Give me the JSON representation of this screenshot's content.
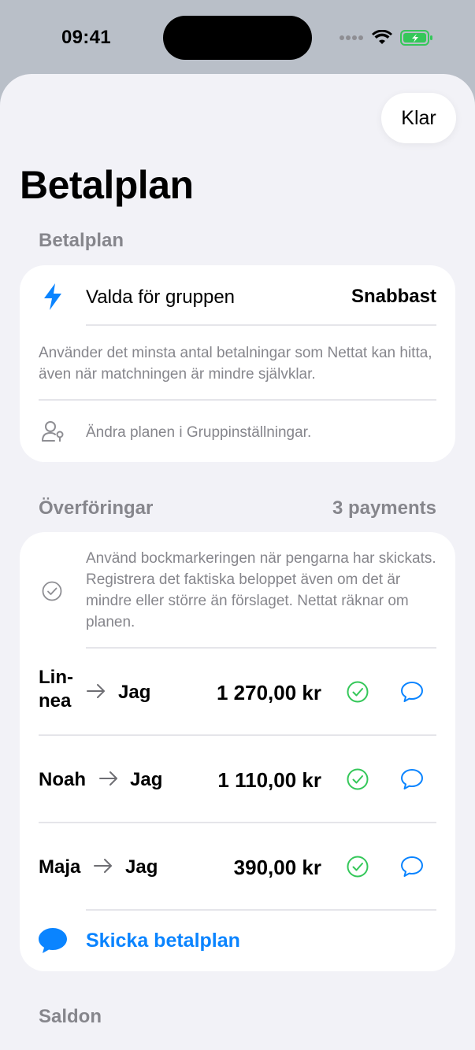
{
  "status": {
    "time": "09:41"
  },
  "header": {
    "done_label": "Klar",
    "title": "Betalplan"
  },
  "plan_section": {
    "header": "Betalplan",
    "row_label": "Valda för gruppen",
    "row_value": "Snabbast",
    "description": "Använder det minsta antal betalningar som Nettat kan hitta, även när matchningen är mindre självklar.",
    "settings_hint": "Ändra planen i Gruppinställningar."
  },
  "transfers_section": {
    "header": "Överföringar",
    "count": "3 payments",
    "info": "Använd bockmarkeringen när pengarna har skickats. Registrera det faktiska beloppet även om det är mindre eller större än förslaget. Nettat räknar om planen.",
    "payments": [
      {
        "from_line1": "Lin-",
        "from_line2": "nea",
        "to": "Jag",
        "amount": "1 270,00 kr"
      },
      {
        "from": "Noah",
        "to": "Jag",
        "amount": "1 110,00 kr"
      },
      {
        "from": "Maja",
        "to": "Jag",
        "amount": "390,00 kr"
      }
    ],
    "send_label": "Skicka betalplan"
  },
  "balances_section": {
    "header": "Saldon"
  },
  "colors": {
    "accent": "#0a84ff",
    "success": "#34c759",
    "secondary_text": "#86868c"
  },
  "icons": [
    "bolt-icon",
    "person-key-icon",
    "check-circle-icon",
    "message-icon",
    "arrow-right-icon",
    "wifi-icon",
    "battery-icon",
    "cellular-icon"
  ]
}
